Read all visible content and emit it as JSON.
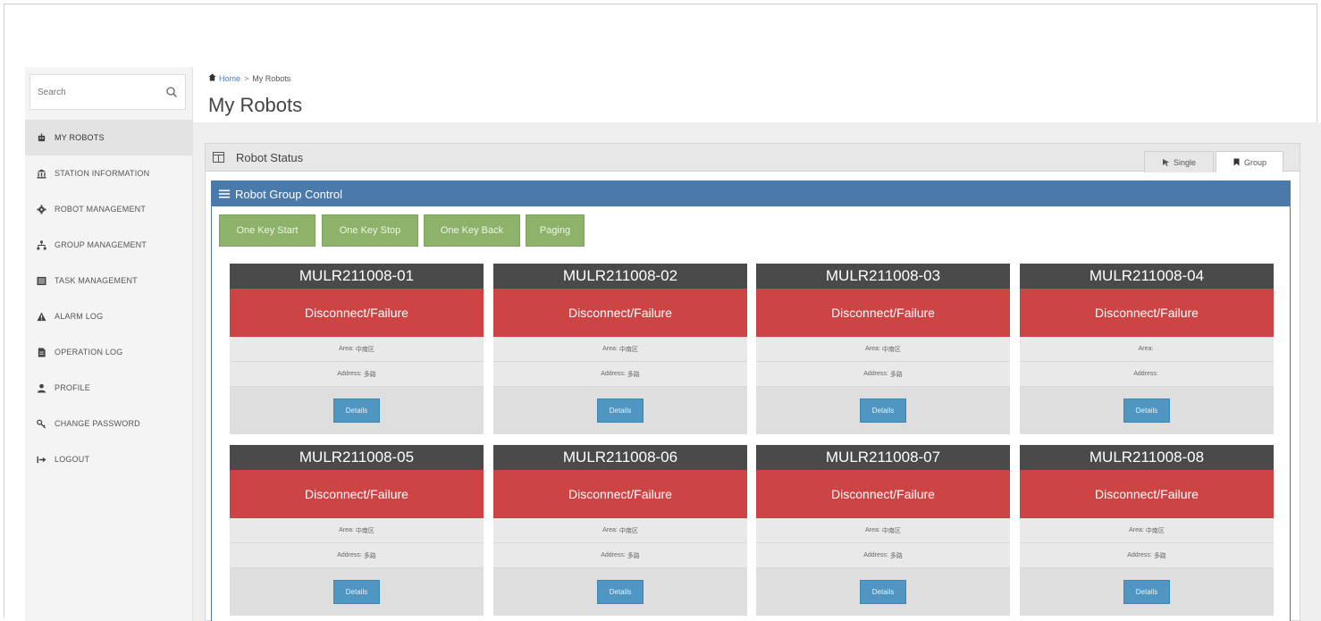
{
  "search": {
    "placeholder": "Search"
  },
  "sidebar": {
    "items": [
      {
        "label": "MY ROBOTS",
        "icon": "robot-icon",
        "active": true
      },
      {
        "label": "STATION INFORMATION",
        "icon": "bank-icon",
        "active": false
      },
      {
        "label": "ROBOT MANAGEMENT",
        "icon": "gear-icon",
        "active": false
      },
      {
        "label": "GROUP MANAGEMENT",
        "icon": "sitemap-icon",
        "active": false
      },
      {
        "label": "TASK MANAGEMENT",
        "icon": "list-icon",
        "active": false
      },
      {
        "label": "ALARM LOG",
        "icon": "warning-icon",
        "active": false
      },
      {
        "label": "OPERATION LOG",
        "icon": "file-icon",
        "active": false
      },
      {
        "label": "PROFILE",
        "icon": "user-icon",
        "active": false
      },
      {
        "label": "CHANGE PASSWORD",
        "icon": "key-icon",
        "active": false
      },
      {
        "label": "LOGOUT",
        "icon": "logout-icon",
        "active": false
      }
    ]
  },
  "breadcrumb": {
    "home": "Home",
    "separator": ">",
    "current": "My Robots"
  },
  "page_title": "My Robots",
  "status_panel": {
    "title": "Robot Status",
    "tabs": {
      "single": "Single",
      "group": "Group"
    }
  },
  "group_control": {
    "title": "Robot Group Control",
    "buttons": [
      "One Key Start",
      "One Key Stop",
      "One Key Back",
      "Paging"
    ]
  },
  "robots": [
    {
      "name": "MULR211008-01",
      "status": "Disconnect/Failure",
      "area_label": "Area:",
      "area": "中南区",
      "address_label": "Address:",
      "address": "多路",
      "details": "Details"
    },
    {
      "name": "MULR211008-02",
      "status": "Disconnect/Failure",
      "area_label": "Area:",
      "area": "中南区",
      "address_label": "Address:",
      "address": "多路",
      "details": "Details"
    },
    {
      "name": "MULR211008-03",
      "status": "Disconnect/Failure",
      "area_label": "Area:",
      "area": "中南区",
      "address_label": "Address:",
      "address": "多路",
      "details": "Details"
    },
    {
      "name": "MULR211008-04",
      "status": "Disconnect/Failure",
      "area_label": "Area:",
      "area": "",
      "address_label": "Address:",
      "address": "",
      "details": "Details"
    },
    {
      "name": "MULR211008-05",
      "status": "Disconnect/Failure",
      "area_label": "Area:",
      "area": "中南区",
      "address_label": "Address:",
      "address": "多路",
      "details": "Details"
    },
    {
      "name": "MULR211008-06",
      "status": "Disconnect/Failure",
      "area_label": "Area:",
      "area": "中南区",
      "address_label": "Address:",
      "address": "多路",
      "details": "Details"
    },
    {
      "name": "MULR211008-07",
      "status": "Disconnect/Failure",
      "area_label": "Area:",
      "area": "中南区",
      "address_label": "Address:",
      "address": "多路",
      "details": "Details"
    },
    {
      "name": "MULR211008-08",
      "status": "Disconnect/Failure",
      "area_label": "Area:",
      "area": "中南区",
      "address_label": "Address:",
      "address": "多路",
      "details": "Details"
    }
  ],
  "colors": {
    "status_failure": "#cc4444",
    "card_header": "#4a4a4a",
    "group_header": "#4a7aac",
    "control_button": "#8db26a",
    "details_button": "#4f97c2"
  }
}
